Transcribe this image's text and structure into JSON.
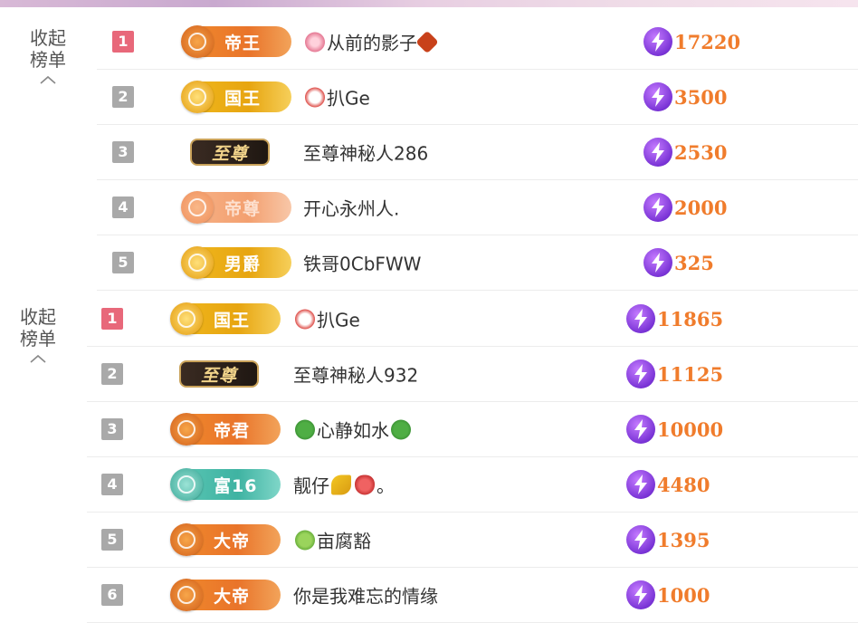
{
  "collapse_label_line1": "收起",
  "collapse_label_line2": "榜单",
  "boards": [
    {
      "rows": [
        {
          "rank": "1",
          "badge": "帝王",
          "badge_style": "orange",
          "name": "从前的影子",
          "emoji_before": "flower",
          "emoji_after": "leaf",
          "score": "17220"
        },
        {
          "rank": "2",
          "badge": "国王",
          "badge_style": "gold",
          "name": "扒Ge",
          "emoji_before": "rooster",
          "emoji_after": "",
          "score": "3500"
        },
        {
          "rank": "3",
          "badge": "至尊",
          "badge_style": "vip",
          "name": "至尊神秘人286",
          "emoji_before": "",
          "emoji_after": "",
          "score": "2530"
        },
        {
          "rank": "4",
          "badge": "帝尊",
          "badge_style": "faded",
          "name": "开心永州人.",
          "emoji_before": "",
          "emoji_after": "",
          "score": "2000"
        },
        {
          "rank": "5",
          "badge": "男爵",
          "badge_style": "gold",
          "name": "铁哥0CbFWW",
          "emoji_before": "",
          "emoji_after": "",
          "score": "325"
        }
      ]
    },
    {
      "rows": [
        {
          "rank": "1",
          "badge": "国王",
          "badge_style": "gold",
          "name": "扒Ge",
          "emoji_before": "rooster",
          "emoji_after": "",
          "score": "11865"
        },
        {
          "rank": "2",
          "badge": "至尊",
          "badge_style": "vip",
          "name": "至尊神秘人932",
          "emoji_before": "",
          "emoji_after": "",
          "score": "11125"
        },
        {
          "rank": "3",
          "badge": "帝君",
          "badge_style": "orange",
          "name": "心静如水",
          "emoji_before": "clover",
          "emoji_after": "clover",
          "score": "10000"
        },
        {
          "rank": "4",
          "badge": "富16",
          "badge_style": "teal",
          "name": "靓仔",
          "emoji_before": "",
          "emoji_after": "banana,berry",
          "suffix": "。",
          "score": "4480"
        },
        {
          "rank": "5",
          "badge": "大帝",
          "badge_style": "orange",
          "name": "亩腐豁",
          "emoji_before": "frog",
          "emoji_after": "",
          "score": "1395"
        },
        {
          "rank": "6",
          "badge": "大帝",
          "badge_style": "orange",
          "name": "你是我难忘的情缘",
          "emoji_before": "",
          "emoji_after": "",
          "score": "1000"
        }
      ]
    }
  ],
  "colors": {
    "accent": "#f07c2c",
    "rank_first": "#e8687a",
    "rank_other": "#a9a9a9",
    "bolt": "#7a34d6"
  },
  "icons": {
    "score": "lightning-bolt-icon",
    "collapse": "chevron-up-icon"
  }
}
